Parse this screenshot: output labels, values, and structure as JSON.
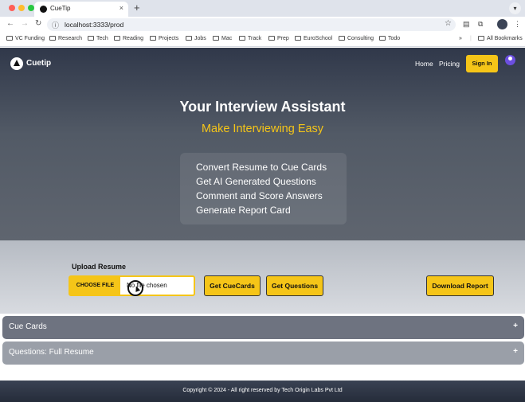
{
  "browser": {
    "tab_title": "CueTip",
    "tab_close": "×",
    "new_tab": "+",
    "url": "localhost:3333/prod",
    "bookmarks": [
      "VC Funding",
      "Research",
      "Tech",
      "Reading",
      "Projects",
      "Jobs",
      "Mac",
      "Track",
      "Prep",
      "EuroSchool",
      "Consulting",
      "Todo"
    ],
    "more_bookmarks": "»",
    "all_bookmarks": "All Bookmarks"
  },
  "header": {
    "brand": "Cuetip",
    "nav": [
      "Home",
      "Pricing"
    ],
    "sign_in": "Sign In"
  },
  "hero": {
    "title": "Your Interview Assistant",
    "subtitle": "Make Interviewing Easy",
    "features": [
      "Convert Resume to Cue Cards",
      "Get AI Generated Questions",
      "Comment and Score Answers",
      "Generate Report Card"
    ]
  },
  "upload": {
    "label": "Upload Resume",
    "choose_file": "CHOOSE FILE",
    "file_status": "No file chosen",
    "get_cuecards": "Get CueCards",
    "get_questions": "Get Questions",
    "download_report": "Download Report"
  },
  "accordions": [
    {
      "title": "Cue Cards",
      "icon": "+"
    },
    {
      "title": "Questions: Full Resume",
      "icon": "+"
    }
  ],
  "footer": {
    "copyright": "Copyright © 2024 - All right reserved by Tech Origin Labs Pvt Ltd"
  },
  "colors": {
    "accent": "#f5c518",
    "hero_dark": "#30384a",
    "accordion_dark": "#6e7380",
    "accordion_light": "#9a9fa8"
  }
}
